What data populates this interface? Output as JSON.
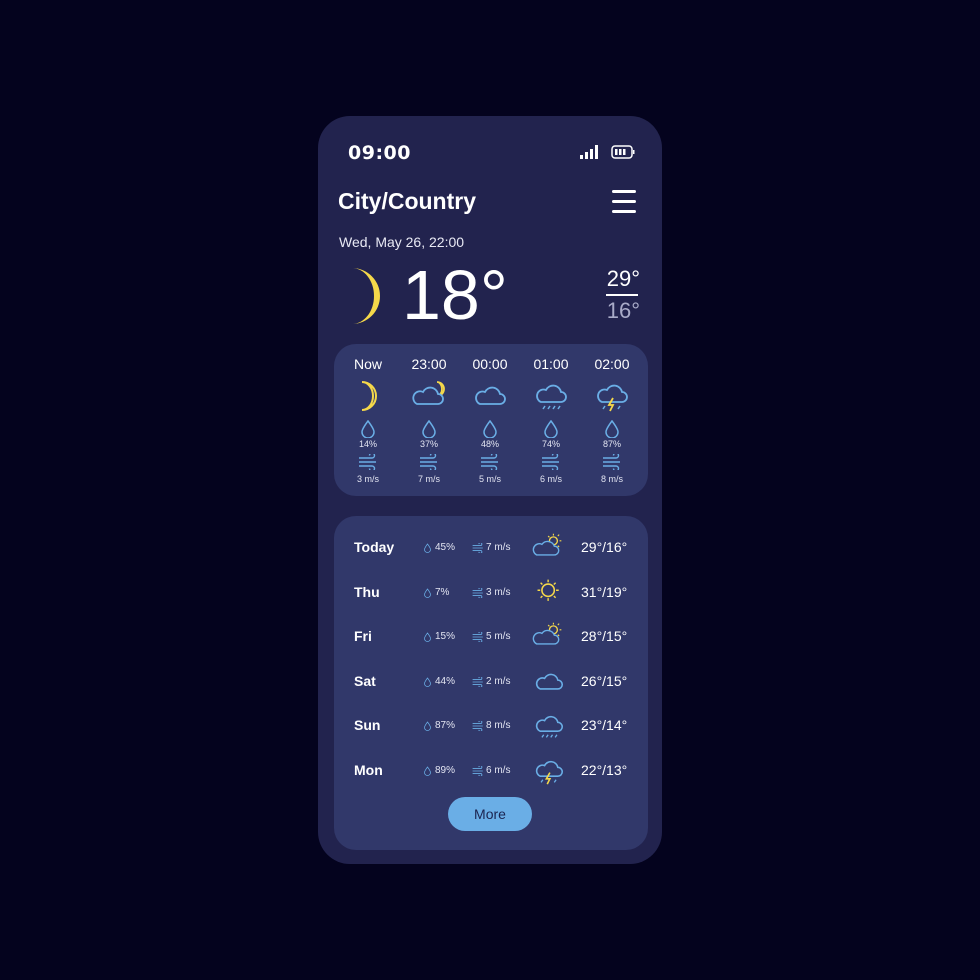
{
  "status": {
    "time": "09:00",
    "signal_icon": "signal-icon",
    "battery_icon": "battery-icon"
  },
  "header": {
    "location": "City/Country",
    "menu_icon": "hamburger-menu-icon",
    "date": "Wed, May 26, 22:00"
  },
  "current": {
    "icon": "moon",
    "temperature": "18°",
    "high": "29°",
    "low": "16°"
  },
  "colors": {
    "background": "#04031e",
    "phone": "#22234e",
    "card": "#31386a",
    "accent": "#6aaee6",
    "sun": "#f5d84a"
  },
  "hourly": [
    {
      "time": "Now",
      "icon": "moon",
      "precip": "14%",
      "wind": "3 m/s"
    },
    {
      "time": "23:00",
      "icon": "cloud-moon",
      "precip": "37%",
      "wind": "7 m/s"
    },
    {
      "time": "00:00",
      "icon": "cloud",
      "precip": "48%",
      "wind": "5 m/s"
    },
    {
      "time": "01:00",
      "icon": "rain",
      "precip": "74%",
      "wind": "6 m/s"
    },
    {
      "time": "02:00",
      "icon": "thunderstorm",
      "precip": "87%",
      "wind": "8 m/s"
    }
  ],
  "daily": [
    {
      "day": "Today",
      "precip": "45%",
      "wind": "7 m/s",
      "icon": "partly-cloudy",
      "temps": "29°/16°"
    },
    {
      "day": "Thu",
      "precip": "7%",
      "wind": "3 m/s",
      "icon": "sun",
      "temps": "31°/19°"
    },
    {
      "day": "Fri",
      "precip": "15%",
      "wind": "5 m/s",
      "icon": "partly-cloudy",
      "temps": "28°/15°"
    },
    {
      "day": "Sat",
      "precip": "44%",
      "wind": "2 m/s",
      "icon": "cloud",
      "temps": "26°/15°"
    },
    {
      "day": "Sun",
      "precip": "87%",
      "wind": "8 m/s",
      "icon": "rain",
      "temps": "23°/14°"
    },
    {
      "day": "Mon",
      "precip": "89%",
      "wind": "6 m/s",
      "icon": "thunderstorm",
      "temps": "22°/13°"
    }
  ],
  "more_label": "More"
}
